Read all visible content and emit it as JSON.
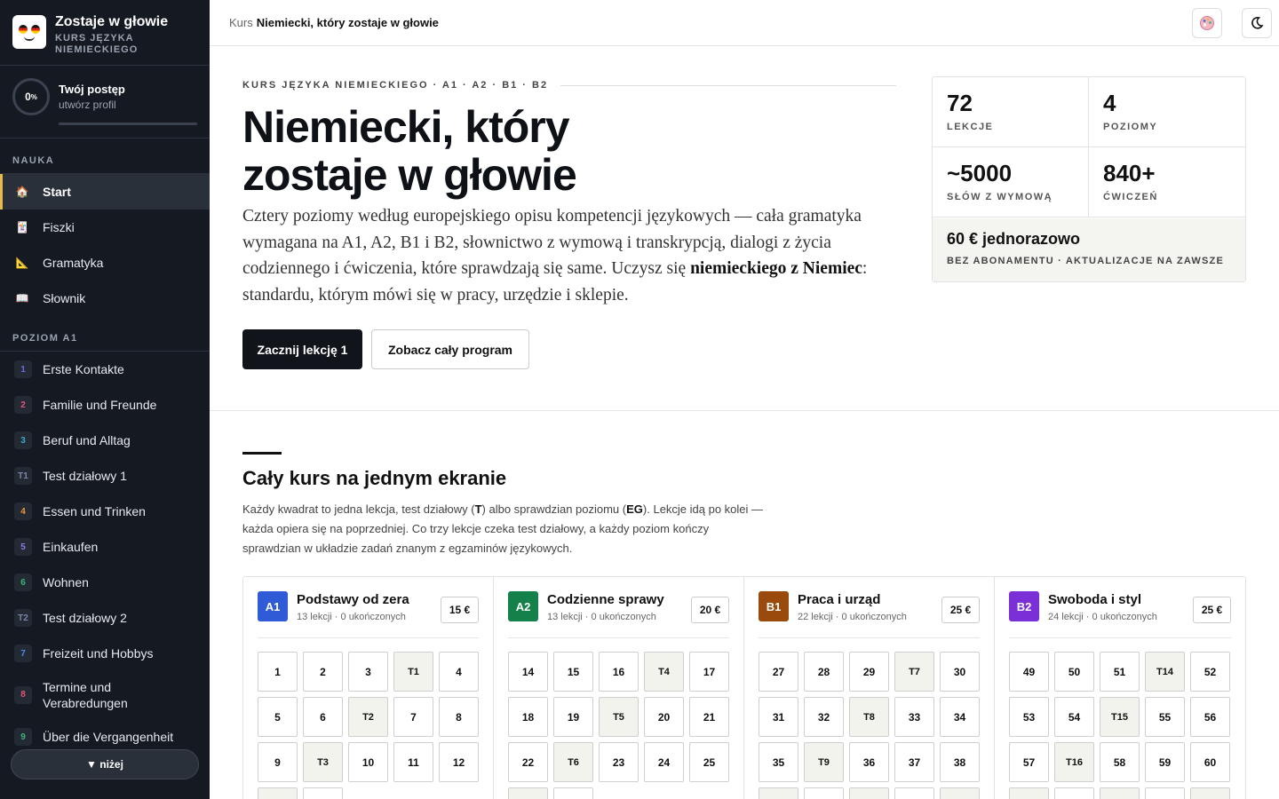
{
  "brand": {
    "title": "Zostaje w głowie",
    "subtitle": "KURS JĘZYKA NIEMIECKIEGO"
  },
  "progress": {
    "percent": "0",
    "unit": "%",
    "title": "Twój postęp",
    "subtitle": "utwórz profil",
    "fraction": 0
  },
  "nav": {
    "section_learning": "NAUKA",
    "learning": [
      {
        "label": "Start",
        "icon": "home-icon",
        "glyph": "🏠",
        "active": true
      },
      {
        "label": "Fiszki",
        "icon": "flashcards-icon",
        "glyph": "🃏"
      },
      {
        "label": "Gramatyka",
        "icon": "ruler-triangle-icon",
        "glyph": "📐"
      },
      {
        "label": "Słownik",
        "icon": "book-icon",
        "glyph": "📖"
      }
    ],
    "section_level": "POZIOM A1",
    "lessons": [
      {
        "num": "1",
        "label": "Erste Kontakte",
        "color": "#6a6ee8"
      },
      {
        "num": "2",
        "label": "Familie und Freunde",
        "color": "#e0577a"
      },
      {
        "num": "3",
        "label": "Beruf und Alltag",
        "color": "#3fa9c9"
      },
      {
        "num": "T1",
        "label": "Test działowy 1",
        "color": "#7a86a8"
      },
      {
        "num": "4",
        "label": "Essen und Trinken",
        "color": "#e8983a"
      },
      {
        "num": "5",
        "label": "Einkaufen",
        "color": "#8a7be8"
      },
      {
        "num": "6",
        "label": "Wohnen",
        "color": "#3fb37a"
      },
      {
        "num": "T2",
        "label": "Test działowy 2",
        "color": "#7a86a8"
      },
      {
        "num": "7",
        "label": "Freizeit und Hobbys",
        "color": "#4a8ae8"
      },
      {
        "num": "8",
        "label": "Termine und Verabredungen",
        "color": "#e0577a"
      },
      {
        "num": "9",
        "label": "Über die Vergangenheit",
        "color": "#3fb37a"
      }
    ],
    "scroll_label": "▼ niżej"
  },
  "header": {
    "crumb_root": "Kurs",
    "crumb_current": "Niemiecki, który zostaje w głowie"
  },
  "hero": {
    "eyebrow": "KURS JĘZYKA NIEMIECKIEGO · A1 · A2 · B1 · B2",
    "title_line1": "Niemiecki, który",
    "title_line2": "zostaje w głowie",
    "desc_before": "Cztery poziomy według europejskiego opisu kompetencji językowych — cała gramatyka wymagana na A1, A2, B1 i B2, słownictwo z wymową i transkrypcją, dialogi z życia codziennego i ćwiczenia, które sprawdzają się same. Uczysz się ",
    "desc_bold": "niemieckiego z Niemiec",
    "desc_after": ": standardu, którym mówi się w pracy, urzędzie i sklepie.",
    "cta_primary": "Zacznij lekcję 1",
    "cta_secondary": "Zobacz cały program"
  },
  "stats": [
    {
      "value": "72",
      "label": "LEKCJE"
    },
    {
      "value": "4",
      "label": "POZIOMY"
    },
    {
      "value": "~5000",
      "label": "SŁÓW Z WYMOWĄ"
    },
    {
      "value": "840+",
      "label": "ĆWICZEŃ"
    }
  ],
  "price": {
    "value": "60 € jednorazowo",
    "subtitle": "BEZ ABONAMENTU · AKTUALIZACJE NA ZAWSZE"
  },
  "overview": {
    "title": "Cały kurs na jednym ekranie",
    "desc_p1": "Każdy kwadrat to jedna lekcja, test działowy (",
    "desc_t": "T",
    "desc_p2": ") albo sprawdzian poziomu (",
    "desc_eg": "EG",
    "desc_p3": "). Lekcje idą po kolei — każda opiera się na poprzedniej. Co trzy lekcje czeka test działowy, a każdy poziom kończy sprawdzian w układzie zadań znanym z egzaminów językowych."
  },
  "levels": [
    {
      "badge": "A1",
      "color": "#2f5bd6",
      "name": "Podstawy od zera",
      "meta": "13 lekcji · 0 ukończonych",
      "price": "15 €",
      "cells": [
        "1",
        "2",
        "3",
        "T1",
        "4",
        "5",
        "6",
        "T2",
        "7",
        "8",
        "9",
        "T3",
        "10",
        "11",
        "12",
        "",
        ""
      ]
    },
    {
      "badge": "A2",
      "color": "#14804a",
      "name": "Codzienne sprawy",
      "meta": "13 lekcji · 0 ukończonych",
      "price": "20 €",
      "cells": [
        "14",
        "15",
        "16",
        "T4",
        "17",
        "18",
        "19",
        "T5",
        "20",
        "21",
        "22",
        "T6",
        "23",
        "24",
        "25",
        "",
        ""
      ]
    },
    {
      "badge": "B1",
      "color": "#9a4a0c",
      "name": "Praca i urząd",
      "meta": "22 lekcji · 0 ukończonych",
      "price": "25 €",
      "cells": [
        "27",
        "28",
        "29",
        "T7",
        "30",
        "31",
        "32",
        "T8",
        "33",
        "34",
        "35",
        "T9",
        "36",
        "37",
        "38",
        "",
        "",
        "",
        "",
        ""
      ]
    },
    {
      "badge": "B2",
      "color": "#7b2fd6",
      "name": "Swoboda i styl",
      "meta": "24 lekcji · 0 ukończonych",
      "price": "25 €",
      "cells": [
        "49",
        "50",
        "51",
        "T14",
        "52",
        "53",
        "54",
        "T15",
        "55",
        "56",
        "57",
        "T16",
        "58",
        "59",
        "60",
        "",
        "",
        "",
        "",
        ""
      ]
    }
  ],
  "icons": {
    "theme": "palette-icon",
    "dark_mode": "moon-icon"
  },
  "colors": {
    "accent": "#e8b84a",
    "sidebar_bg": "#151a22",
    "primary_btn": "#11151b"
  }
}
